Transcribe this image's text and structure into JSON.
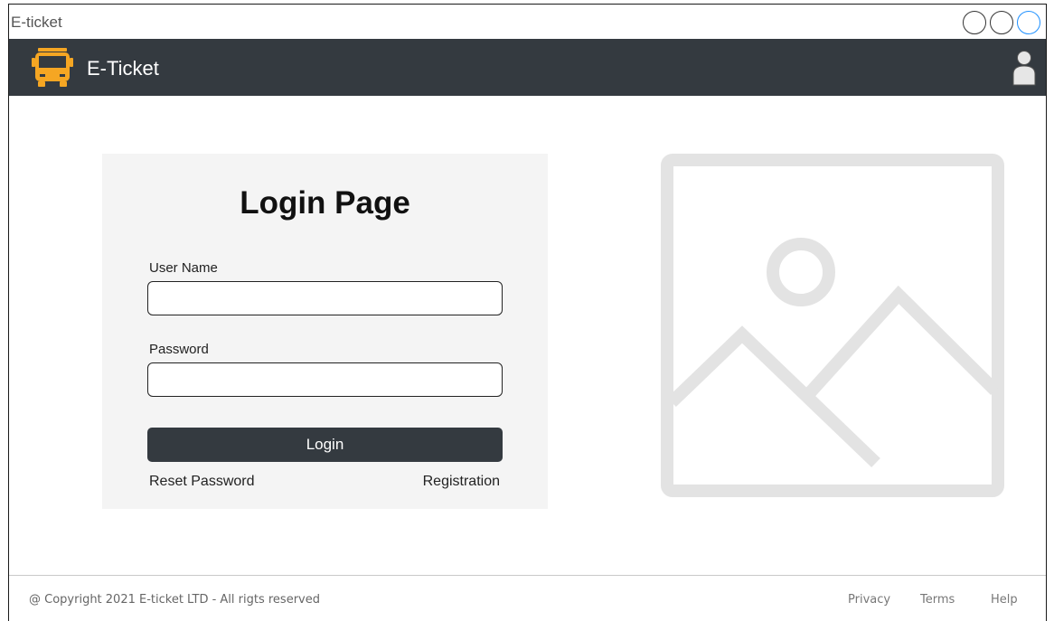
{
  "window": {
    "title": "E-ticket"
  },
  "navbar": {
    "brand": "E-Ticket",
    "brand_icon": "bus-icon",
    "user_icon": "user-icon",
    "brand_color": "#f5a623",
    "bar_color": "#343a40"
  },
  "login": {
    "title": "Login Page",
    "username_label": "User Name",
    "username_value": "",
    "password_label": "Password",
    "password_value": "",
    "login_button": "Login",
    "reset_link": "Reset Password",
    "register_link": "Registration"
  },
  "image": {
    "icon": "image-placeholder-icon"
  },
  "footer": {
    "copyright": "@ Copyright 2021 E-ticket LTD - All rigts reserved",
    "links": [
      "Privacy",
      "Terms",
      "Help"
    ]
  }
}
